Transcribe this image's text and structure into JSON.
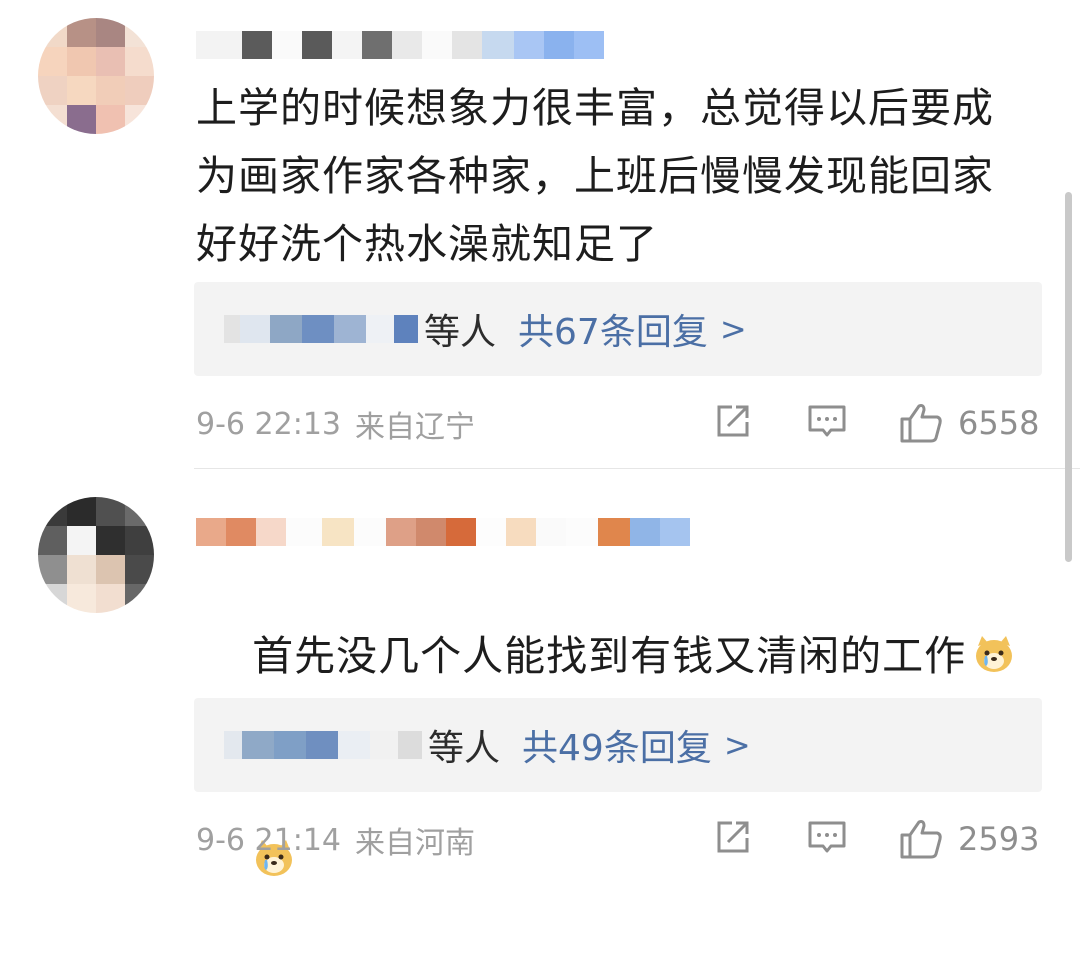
{
  "comments": [
    {
      "text": "上学的时候想象力很丰富，总觉得以后要成为画家作家各种家，上班后慢慢发现能回家好好洗个热水澡就知足了",
      "reply_suffix": "等人",
      "reply_count": "共67条回复",
      "reply_chevron": ">",
      "date": "9-6 22:13",
      "location": "来自辽宁",
      "likes": "6558"
    },
    {
      "text": "首先没几个人能找到有钱又清闲的工作",
      "reply_suffix": "等人",
      "reply_count": "共49条回复",
      "reply_chevron": ">",
      "date": "9-6 21:14",
      "location": "来自河南",
      "likes": "2593"
    }
  ],
  "icons": {
    "share": "share-icon",
    "comment": "comment-icon",
    "like": "thumbs-up-icon",
    "emoji": "crying-dog-emoji-icon"
  },
  "colors": {
    "link_blue": "#4b6fa5",
    "meta_gray": "#a0a0a0",
    "reply_bg": "#f3f3f3"
  }
}
